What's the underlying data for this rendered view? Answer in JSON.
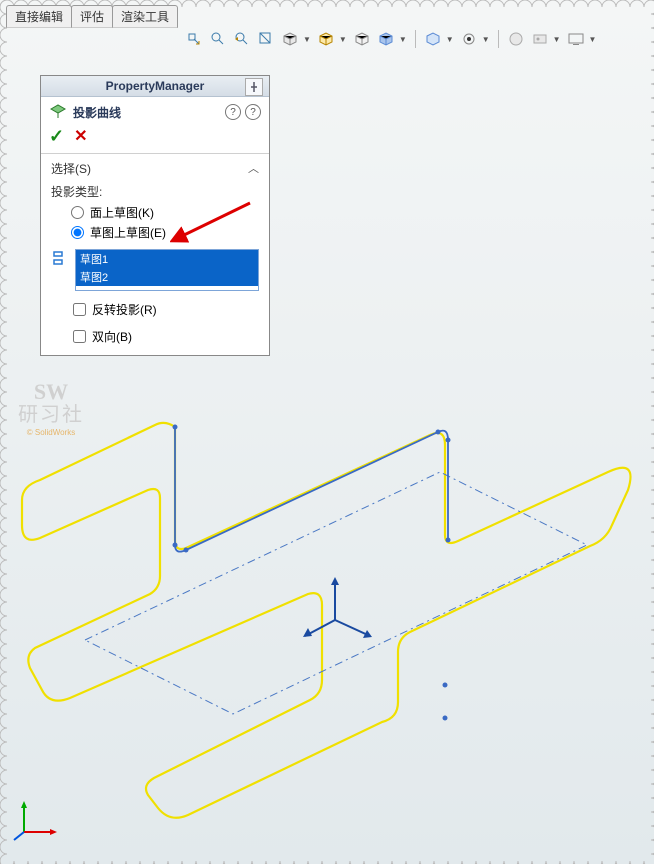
{
  "tabs": {
    "t0": "直接编辑",
    "t1": "评估",
    "t2": "渲染工具"
  },
  "pm": {
    "title": "PropertyManager"
  },
  "feature": {
    "name": "投影曲线"
  },
  "section": {
    "title": "选择(S)",
    "label_type": "投影类型:",
    "radio_face": "面上草图(K)",
    "radio_sketch": "草图上草图(E)",
    "list": {
      "item0": "草图1",
      "item1": "草图2"
    },
    "chk_reverse": "反转投影(R)",
    "chk_bi": "双向(B)"
  },
  "watermark": {
    "line1": "SW",
    "line2": "研习社",
    "line3": "© SolidWorks"
  }
}
